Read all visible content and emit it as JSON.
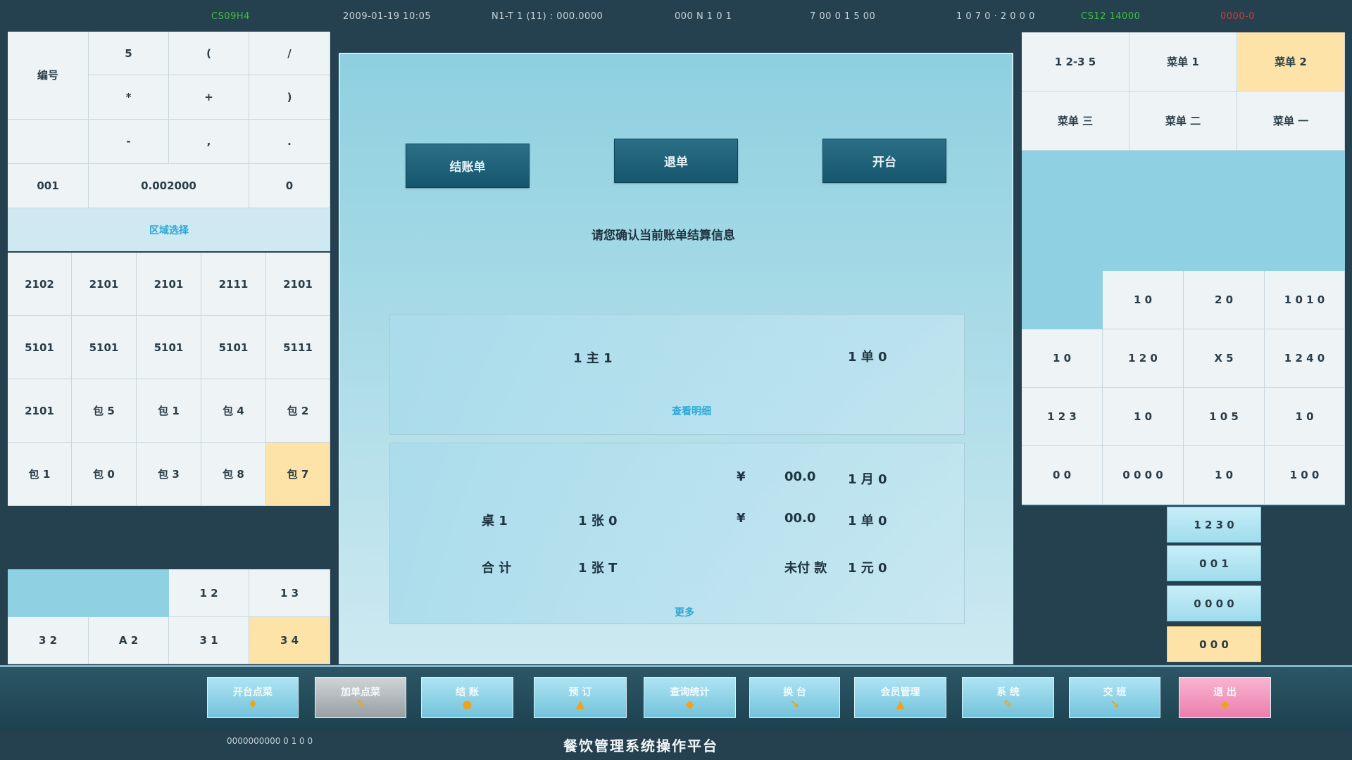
{
  "status_bar": [
    {
      "text": "CS09H4",
      "tone": "green"
    },
    {
      "text": "2009-01-19 10:05",
      "tone": "normal"
    },
    {
      "text": "N1-T 1 (11) : 000.0000",
      "tone": "normal"
    },
    {
      "text": "000 N 1 0 1",
      "tone": "normal"
    },
    {
      "text": "7 00 0 1 5 00",
      "tone": "normal"
    },
    {
      "text": "1 0 7 0 · 2 0 0 0",
      "tone": "normal"
    },
    {
      "text": "CS12 14000",
      "tone": "green"
    },
    {
      "text": "0000-0",
      "tone": "red"
    }
  ],
  "left_grid_top": {
    "rows": [
      [
        "编号",
        "5",
        "(",
        "/"
      ],
      [
        "",
        "*",
        "+",
        ")"
      ],
      [
        "",
        "-",
        ",",
        "."
      ],
      [
        "001",
        "0.002000",
        "0"
      ]
    ],
    "section_label": "区域选择"
  },
  "left_grid_rooms": [
    [
      "2102",
      "2101",
      "2101",
      "2111",
      "2101"
    ],
    [
      "5101",
      "5101",
      "5101",
      "5101",
      "5111"
    ],
    [
      "2101",
      "包 5",
      "包 1",
      "包 4",
      "包 2"
    ],
    [
      "包 1",
      "包 0",
      "包 3",
      "包 8",
      "包 7"
    ]
  ],
  "left_grid_bottom": {
    "row1": [
      "",
      "1 2",
      "1 3"
    ],
    "row2": [
      "3 2",
      "A 2",
      "3 1",
      "3 4"
    ]
  },
  "center": {
    "mode_buttons": [
      "结账单",
      "退单",
      "开台"
    ],
    "notice": "请您确认当前账单结算信息",
    "summary_left": "1 主 1",
    "summary_right": "1 单 0",
    "summary_link": "查看明细",
    "detail_rows": [
      [
        "",
        "",
        "¥",
        "00.0",
        "1 月 0"
      ],
      [
        "桌 1",
        "1 张 0",
        "¥",
        "00.0",
        "1 单 0"
      ],
      [
        "合 计",
        "1 张 T",
        "",
        "未付 款",
        "1 元 0"
      ]
    ],
    "detail_link": "更多"
  },
  "right_top_grid": [
    [
      "1 2-3 5",
      "菜单 1",
      "菜单 2"
    ],
    [
      "菜单 三",
      "菜单 二",
      "菜单 一"
    ]
  ],
  "right_keypad": [
    [
      "",
      "1 0",
      "2 0",
      "1 0 1 0"
    ],
    [
      "1 0",
      "1 2 0",
      "X 5",
      "1 2 4 0"
    ],
    [
      "1 2 3",
      "1 0",
      "1 0 5",
      "1 0"
    ],
    [
      "0 0",
      "0 0 0 0",
      "1 0",
      "1 0 0"
    ]
  ],
  "right_side_buttons": [
    "1 2 3 0",
    "0 0 1",
    "0 0 0 0",
    "0 0 0"
  ],
  "toolbar": [
    {
      "label": "开台点菜",
      "icon": "♦",
      "style": "normal"
    },
    {
      "label": "加单点菜",
      "icon": "✎",
      "style": "gray"
    },
    {
      "label": "结 账",
      "icon": "●",
      "style": "normal"
    },
    {
      "label": "预 订",
      "icon": "▲",
      "style": "normal"
    },
    {
      "label": "查询统计",
      "icon": "◆",
      "style": "normal"
    },
    {
      "label": "换 台",
      "icon": "↘",
      "style": "normal"
    },
    {
      "label": "会员管理",
      "icon": "▲",
      "style": "normal"
    },
    {
      "label": "系 统",
      "icon": "✎",
      "style": "normal"
    },
    {
      "label": "交 班",
      "icon": "↘",
      "style": "normal"
    },
    {
      "label": "退 出",
      "icon": "◆",
      "style": "pink"
    }
  ],
  "footer": {
    "left": "0000000000 0 1 0 0",
    "title": "餐饮管理系统操作平台"
  },
  "colors": {
    "accent": "#2aa7d8",
    "selected": "#fde3a7",
    "panel": "#8ed0e0",
    "background": "#25414f"
  }
}
